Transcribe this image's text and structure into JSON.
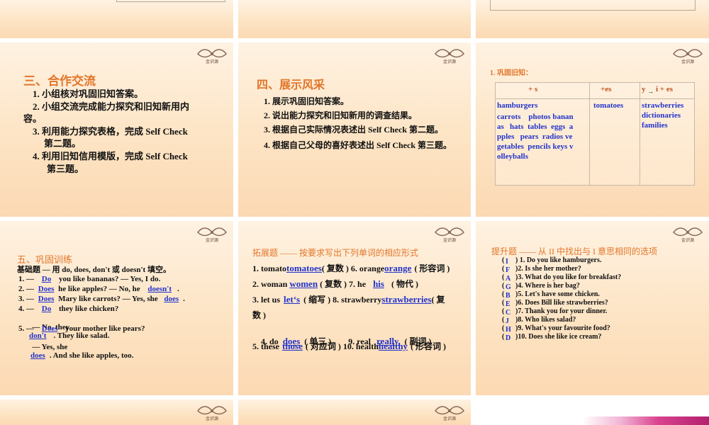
{
  "slide2": {
    "title": "三、合作交流",
    "items": [
      "1.  小组核对巩固旧知答案。",
      "2.  小组交流完成能力探究和旧知新用内",
      "容。",
      "3.  利用能力探究表格，完成 Self Check",
      "第二题。",
      "4.  利用旧知信用模版，完成 Self Check",
      "第三题。"
    ]
  },
  "slide3": {
    "title": "四、展示风采",
    "items": [
      "1.  展示巩固旧知答案。",
      "2.  说出能力探究和旧知新用的调查结果。",
      "3.  根据自己实际情况表述出 Self Check 第二题。",
      "4.  根据自己父母的喜好表述出 Self Check  第三题。"
    ]
  },
  "slide4": {
    "heading": "1.  巩固旧知：",
    "headers": [
      "+ s",
      "+es",
      "y",
      "i + es"
    ],
    "col1": [
      "hamburgers",
      "carrots    photos banan",
      "as   hats  tables  eggs  a",
      "pples   pears  radios ve",
      "getables  pencils keys v",
      "olleyballs"
    ],
    "col2": [
      "tomatoes"
    ],
    "col3": [
      "strawberries",
      "dictionaries",
      "families"
    ]
  },
  "slide5": {
    "title": "五、巩固训练",
    "subtitle": "基础题 — 用 do, does, don't 或 doesn't 填空。",
    "lines": [
      {
        "pre": "1. —",
        "ans": "Do",
        "post": "you like bananas?  — Yes, I do."
      },
      {
        "pre": "2. —",
        "ans": "Does",
        "post": "he like apples?  — No, he",
        "ans2": "doesn't",
        "post2": "."
      },
      {
        "pre": "3. —",
        "ans": "Does",
        "post": "Mary like carrots?  — Yes, she",
        "ans2": "does",
        "post2": "."
      },
      {
        "pre": "4. —",
        "ans": "Do",
        "post": "they like chicken?"
      },
      {
        "pre": "   — No, they",
        "ans": "don't",
        "post": ". They like salad."
      },
      {
        "pre": "5. —",
        "ans": "Does",
        "post": "your mother like pears?"
      },
      {
        "pre": "   — Yes, she",
        "ans": "does",
        "post": ". And she like apples, too."
      }
    ]
  },
  "slide6": {
    "title": "拓展题 —— 按要求写出下列单词的相应形式",
    "rows": [
      {
        "a": "1. tomato",
        "a_ans": "tomatoes",
        "a_note": "( 复数 ) 6. orange",
        "b_ans": "orange",
        "b_note": "( 形容词 )"
      },
      {
        "a": "2. woman",
        "a_ans": "women",
        "a_note": "( 复数 )  7. he",
        "b_ans": "his",
        "b_note": "( 物代 )"
      },
      {
        "a": "3. let us",
        "a_ans": "let‘s",
        "a_note": "( 缩写 ) 8. strawberry",
        "b_ans": "strawberries",
        "b_note": "( 复"
      },
      {
        "a": "数 )"
      },
      {
        "a": "4. do",
        "a_ans": "does",
        "a_note": "( 单三 )        9. real",
        "b_ans": "really",
        "b_note": "( 副词 )"
      },
      {
        "a": "5. these",
        "a_ans": "those",
        "a_note": "( 对应词 )  10. health",
        "b_ans": "healthy",
        "b_note": "( 形容词 )"
      }
    ]
  },
  "slide7": {
    "title": "提升题 —— 从 II 中找出与 I 意思相同的选项",
    "letters": [
      "I",
      "F",
      "A",
      "G",
      "B",
      "E",
      "C",
      "J",
      "H",
      "D"
    ],
    "items": [
      ") 1. Do you like hamburgers.",
      ")2. Is she her mother?",
      ")3. What do you like for breakfast?",
      ")4. Where is her bag?",
      ")5. Let's have some chicken.",
      ")6. Does Bill like strawberries?",
      ")7. Thank you for your dinner.",
      ")8. Who likes salad?",
      ")9. What's your favourite food?",
      ")10. Does she like ice cream?"
    ]
  },
  "logo_text": "金识源",
  "colors": {
    "title": "#e2762a",
    "answer": "#2233cc",
    "slide_bg": "#fde4c4"
  }
}
